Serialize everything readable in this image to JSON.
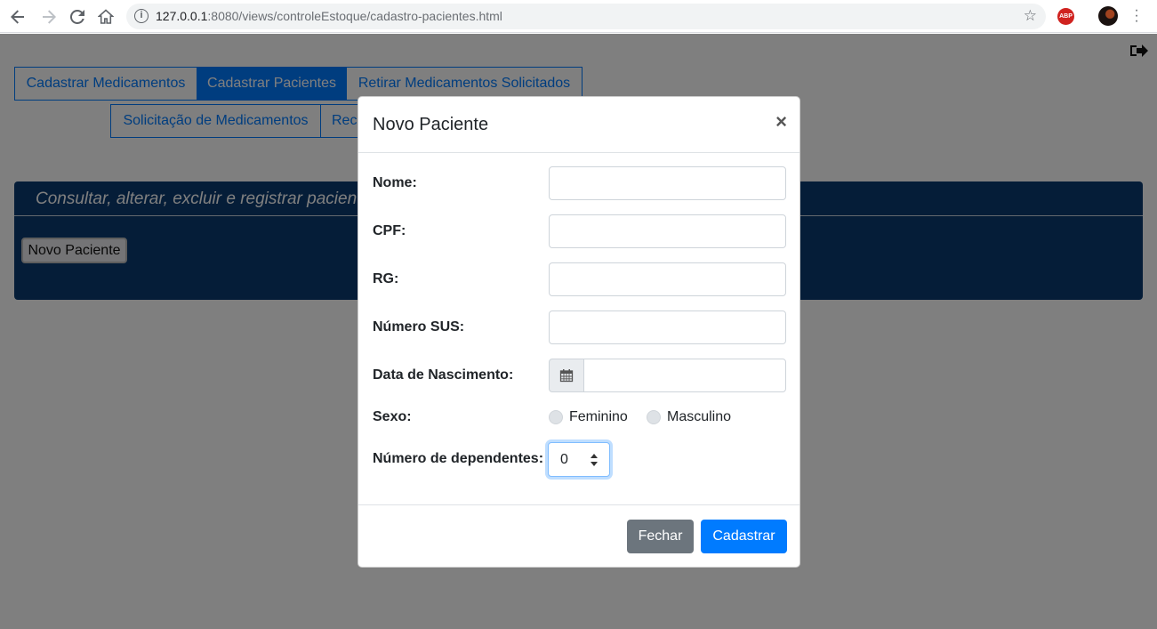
{
  "browser": {
    "url_host": "127.0.0.1",
    "url_rest": ":8080/views/controleEstoque/cadastro-pacientes.html",
    "abp_label": "ABP"
  },
  "tabs": {
    "row1": [
      "Cadastrar Medicamentos",
      "Cadastrar Pacientes",
      "Retirar Medicamentos Solicitados"
    ],
    "row2": [
      "Solicitação de Medicamentos",
      "Rec"
    ]
  },
  "panel": {
    "title": "Consultar, alterar, excluir e registrar pacientes",
    "new_button": "Novo Paciente"
  },
  "modal": {
    "title": "Novo Paciente",
    "close": "×",
    "fields": {
      "nome": "Nome:",
      "cpf": "CPF:",
      "rg": "RG:",
      "sus": "Número SUS:",
      "nascimento": "Data de Nascimento:",
      "sexo": "Sexo:",
      "dependentes": "Número de dependentes:"
    },
    "sexo_options": [
      "Feminino",
      "Masculino"
    ],
    "dependentes_value": "0",
    "buttons": {
      "fechar": "Fechar",
      "cadastrar": "Cadastrar"
    }
  },
  "colors": {
    "primary": "#007bff",
    "secondary": "#6c757d",
    "panel": "#0a3a70"
  }
}
